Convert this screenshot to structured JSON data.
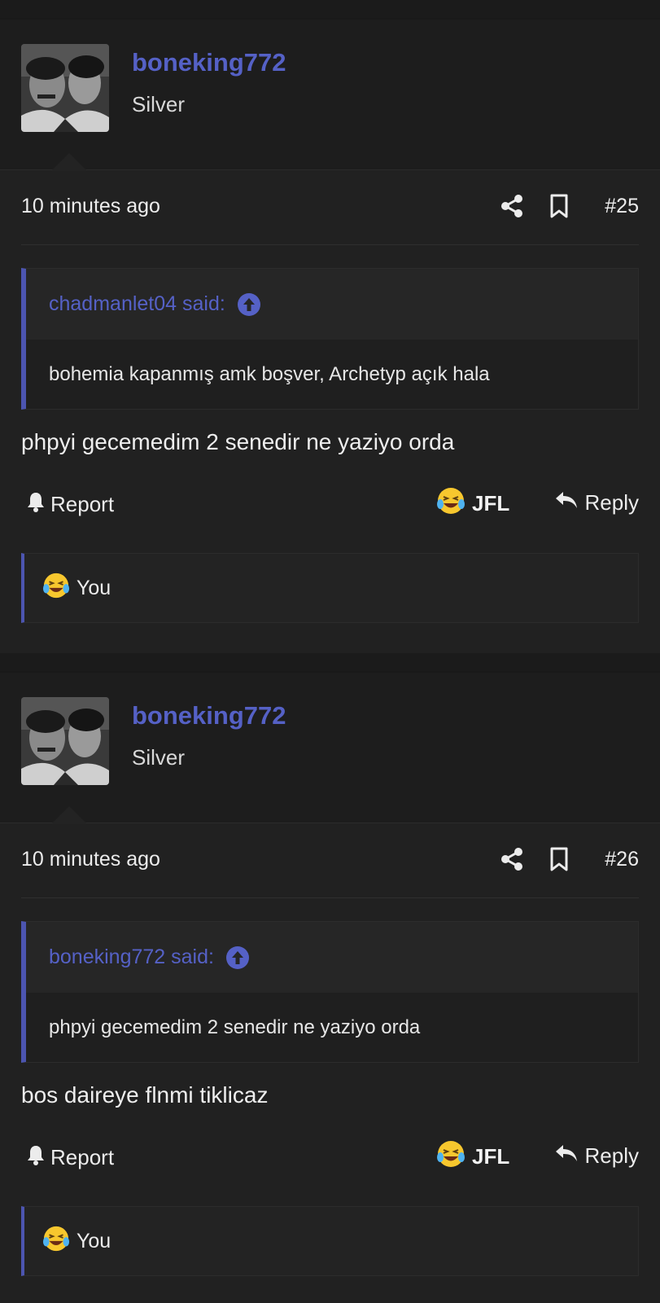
{
  "posts": [
    {
      "username": "boneking772",
      "user_title": "Silver",
      "time": "10 minutes ago",
      "post_number": "#25",
      "quote": {
        "author_said": "chadmanlet04 said:",
        "text": "bohemia kapanmış amk boşver, Archetyp açık hala"
      },
      "message": "phpyi gecemedim 2 senedir ne yaziyo orda",
      "actions": {
        "report": "Report",
        "reaction": "JFL",
        "reply": "Reply"
      },
      "reactions_list": "You"
    },
    {
      "username": "boneking772",
      "user_title": "Silver",
      "time": "10 minutes ago",
      "post_number": "#26",
      "quote": {
        "author_said": "boneking772 said:",
        "text": "phpyi gecemedim 2 senedir ne yaziyo orda"
      },
      "message": "bos daireye flnmi tiklicaz",
      "actions": {
        "report": "Report",
        "reaction": "JFL",
        "reply": "Reply"
      },
      "reactions_list": "You"
    }
  ],
  "colors": {
    "accent": "#5561c6",
    "background": "#212121",
    "quote_bar": "#4c55b0"
  },
  "icons": [
    "share-icon",
    "bookmark-icon",
    "arrow-up-circle-icon",
    "bell-icon",
    "laughing-crying-emoji-icon",
    "reply-arrow-icon"
  ]
}
